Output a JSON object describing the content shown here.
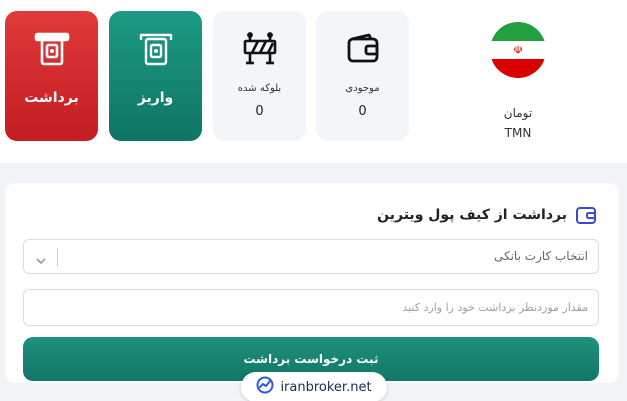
{
  "actions": {
    "withdraw_label": "برداشت",
    "deposit_label": "واریز"
  },
  "stats": {
    "blocked_label": "بلوکه شده",
    "blocked_value": "0",
    "balance_label": "موجودی",
    "balance_value": "0"
  },
  "currency": {
    "name": "تومان",
    "code": "TMN"
  },
  "form": {
    "title": "برداشت از کیف پول ویترین",
    "bank_card_placeholder": "انتخاب کارت بانکی",
    "amount_placeholder": "مقدار موردنظر برداشت خود را وارد کنید",
    "submit_label": "ثبت درخواست برداشت"
  },
  "watermark": {
    "text": "iranbroker.net"
  },
  "colors": {
    "withdraw": "#d42a2e",
    "deposit": "#148570",
    "submit": "#1a8673"
  },
  "icons": [
    "atm-withdraw-icon",
    "atm-deposit-icon",
    "barrier-icon",
    "wallet-icon",
    "iran-flag-icon",
    "chevron-down-icon",
    "chart-logo-icon"
  ]
}
